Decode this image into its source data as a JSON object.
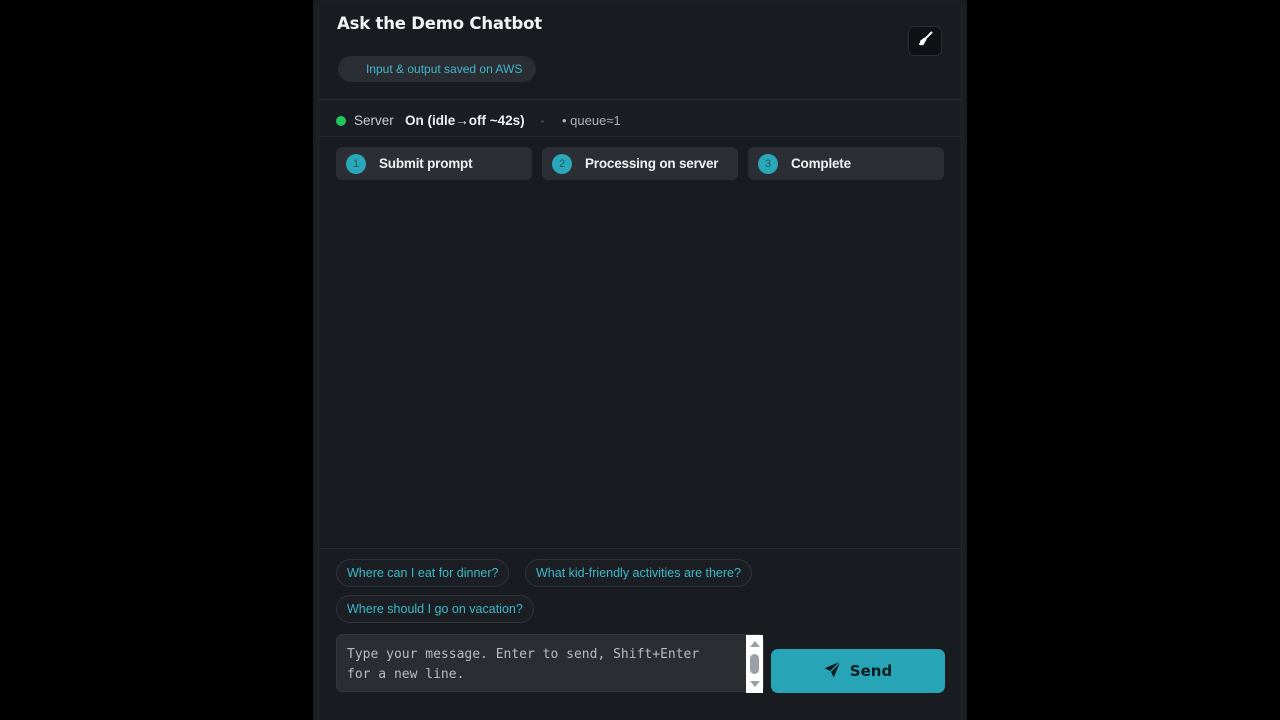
{
  "header": {
    "title": "Ask the Demo Chatbot",
    "aws_notice": "Input & output saved on AWS",
    "clear_icon": "broom-icon"
  },
  "status": {
    "server_label": "Server",
    "server_state": "On (idle→off ~42s)",
    "queue": "• queue≈1",
    "indicator_color": "#22c55e"
  },
  "steps": [
    {
      "number": "1",
      "label": "Submit prompt"
    },
    {
      "number": "2",
      "label": "Processing on server"
    },
    {
      "number": "3",
      "label": "Complete"
    }
  ],
  "suggestions": [
    "Where can I eat for dinner?",
    "What kid-friendly activities are there?",
    "Where should I go on vacation?"
  ],
  "composer": {
    "placeholder": "Type your message. Enter to send, Shift+Enter for a new line.",
    "value": "",
    "send_label": "Send",
    "send_icon": "paper-plane-icon"
  },
  "colors": {
    "accent": "#27a5b7",
    "background": "#181b20"
  }
}
